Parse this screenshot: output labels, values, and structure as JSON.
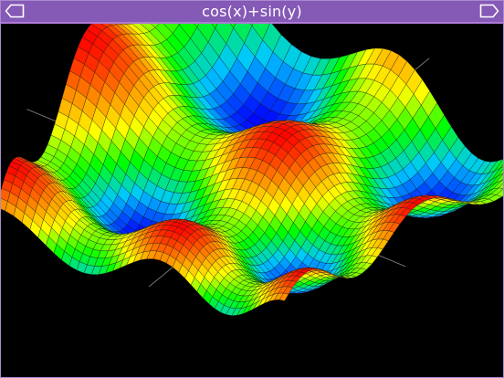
{
  "window": {
    "title": "cos(x)+sin(y)"
  },
  "icons": {
    "back": "back-arrow-icon",
    "forward": "forward-arrow-icon"
  },
  "colors": {
    "titlebar": "#8559b6",
    "background": "#000000",
    "colormap": [
      "#0000ff",
      "#00c8ff",
      "#00ff00",
      "#ffff00",
      "#ff8000",
      "#ff0000"
    ]
  }
}
